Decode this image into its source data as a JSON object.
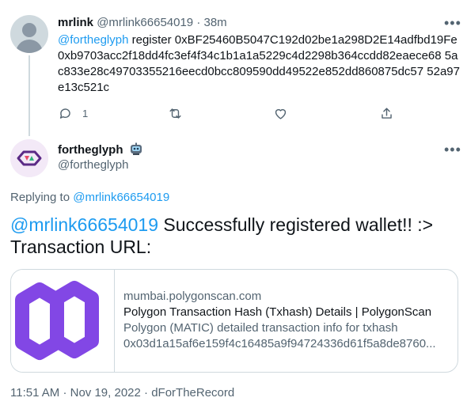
{
  "tweet1": {
    "name": "mrlink",
    "handle": "@mrlink66654019",
    "separator": "·",
    "time": "38m",
    "mention": "@fortheglyph",
    "text": " register 0xBF25460B5047C192d02be1a298D2E14adfbd19Fe 0xb9703acc2f18dd4fc3ef4f34c1b1a1a5229c4d2298b364ccdd82eaece68 5ac833e28c49703355216eecd0bcc809590dd49522e852dd860875dc57 52a97e13c521c",
    "reply_count": "1"
  },
  "tweet2": {
    "name": "fortheglyph",
    "handle": "@fortheglyph",
    "replying_label": "Replying to",
    "replying_to": "@mrlink66654019",
    "mention": "@mrlink66654019",
    "text": " Successfully registered wallet!! :> Transaction URL:"
  },
  "card": {
    "domain": "mumbai.polygonscan.com",
    "title": "Polygon Transaction Hash (Txhash) Details | PolygonScan",
    "desc_line1": "Polygon (MATIC) detailed transaction info for txhash",
    "desc_line2": "0x03d1a15af6e159f4c16485a9f94724336d61f5a8de8760..."
  },
  "meta": {
    "time": "11:51 AM",
    "date": "Nov 19, 2022",
    "source": "dForTheRecord",
    "separator": "·"
  },
  "colors": {
    "accent": "#1d9bf0",
    "polygon_purple": "#8247e5",
    "muted": "#536471"
  }
}
